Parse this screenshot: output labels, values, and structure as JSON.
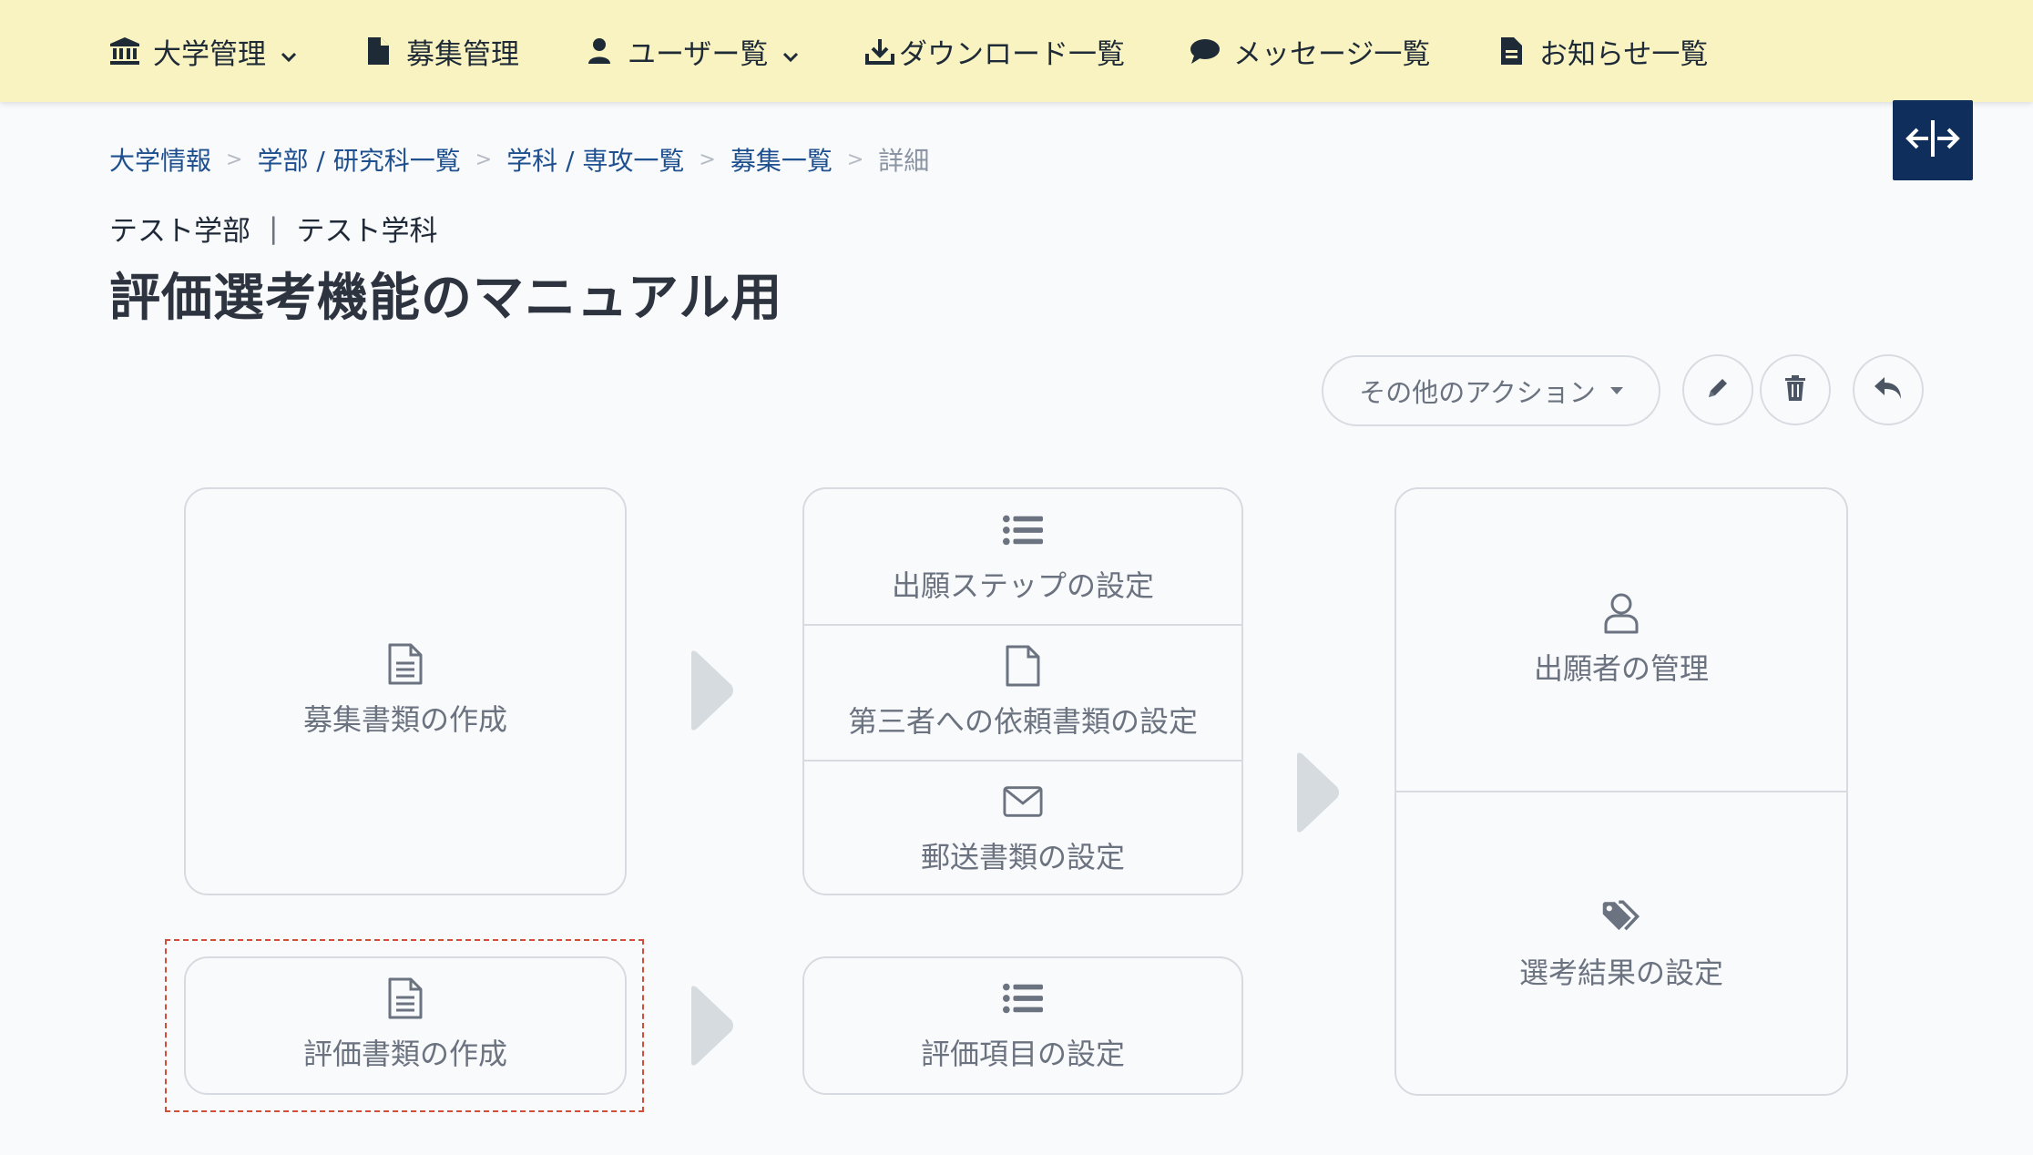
{
  "nav": {
    "items": [
      {
        "label": "大学管理",
        "icon": "university-icon",
        "has_dropdown": true
      },
      {
        "label": "募集管理",
        "icon": "file-icon",
        "has_dropdown": false
      },
      {
        "label": "ユーザー覧",
        "icon": "user-icon",
        "has_dropdown": true
      },
      {
        "label": "ダウンロード一覧",
        "icon": "download-icon",
        "has_dropdown": false
      },
      {
        "label": "メッセージ一覧",
        "icon": "comment-icon",
        "has_dropdown": false
      },
      {
        "label": "お知らせ一覧",
        "icon": "document-icon",
        "has_dropdown": false
      }
    ]
  },
  "breadcrumb": {
    "items": [
      "大学情報",
      "学部 / 研究科一覧",
      "学科 / 専攻一覧",
      "募集一覧"
    ],
    "current": "詳細",
    "separator": ">"
  },
  "header": {
    "faculty": "テスト学部",
    "department": "テスト学科",
    "divider": "|",
    "title": "評価選考機能のマニュアル用"
  },
  "actions": {
    "other_actions_label": "その他のアクション",
    "edit_icon": "pencil-icon",
    "delete_icon": "trash-icon",
    "back_icon": "reply-icon"
  },
  "workflow": {
    "create_recruit_docs": "募集書類の作成",
    "application_steps": "出願ステップの設定",
    "third_party_docs": "第三者への依頼書類の設定",
    "mail_docs": "郵送書類の設定",
    "applicant_management": "出願者の管理",
    "selection_results": "選考結果の設定",
    "create_eval_docs": "評価書類の作成",
    "eval_items": "評価項目の設定"
  },
  "colors": {
    "nav_bg": "#f8f3c1",
    "expand_button_bg": "#0f2e5c",
    "highlight_border": "#d34e3a",
    "link": "#1e4f8f"
  }
}
